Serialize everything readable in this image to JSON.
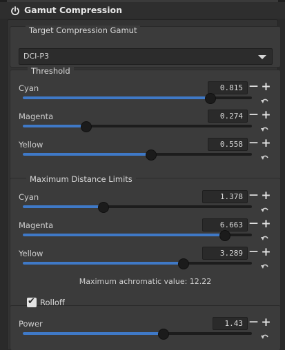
{
  "module": {
    "title": "Gamut Compression"
  },
  "target": {
    "title": "Target Compression Gamut",
    "selected": "DCI-P3"
  },
  "threshold": {
    "title": "Threshold",
    "rows": [
      {
        "label": "Cyan",
        "value": "0.815",
        "level": 0.815
      },
      {
        "label": "Magenta",
        "value": "0.274",
        "level": 0.274
      },
      {
        "label": "Yellow",
        "value": "0.558",
        "level": 0.558
      }
    ]
  },
  "limits": {
    "title": "Maximum Distance Limits",
    "rows": [
      {
        "label": "Cyan",
        "value": "1.378",
        "level": 0.35
      },
      {
        "label": "Magenta",
        "value": "6.663",
        "level": 0.88
      },
      {
        "label": "Yellow",
        "value": "3.289",
        "level": 0.7
      }
    ],
    "note": "Maximum achromatic value: 12.22"
  },
  "rolloff": {
    "label": "Rolloff",
    "checked": true,
    "power_label": "Power",
    "power_value": "1.43",
    "power_level": 0.61
  },
  "colors": {
    "accent": "#3f79c7",
    "panel": "#3b3b3b",
    "background": "#2a2a2a"
  },
  "icons": {
    "power": "power-icon",
    "reset": "reset-arrow-icon",
    "minus": "minus-icon",
    "plus": "plus-icon",
    "check": "checkmark-icon",
    "dropdown": "chevron-down-icon"
  }
}
